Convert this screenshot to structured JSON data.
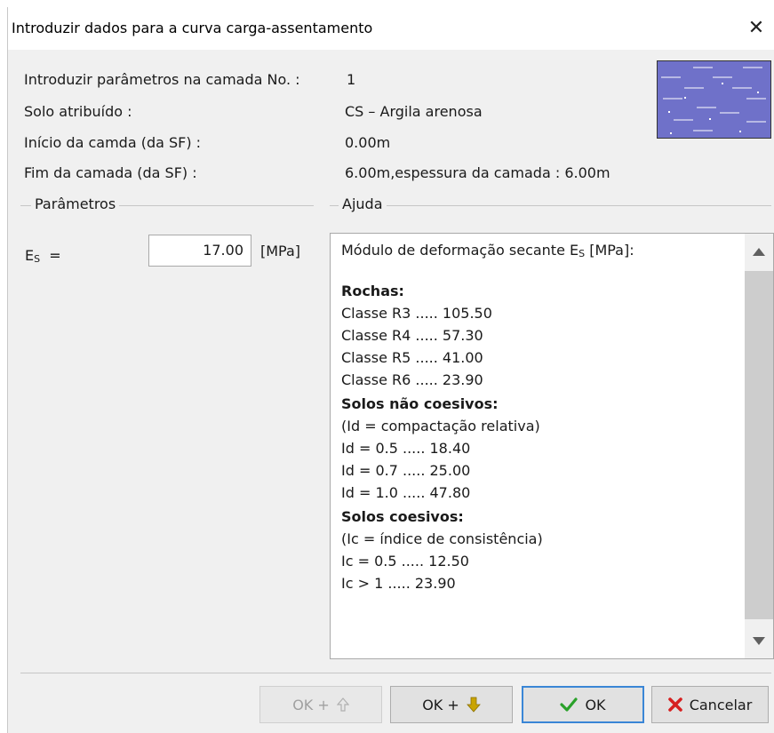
{
  "dialog": {
    "title": "Introduzir dados para a curva carga-assentamento",
    "close_glyph": "✕"
  },
  "info": {
    "layer_label": "Introduzir parâmetros na camada No. :",
    "layer_value": "1",
    "soil_label": "Solo atribuído :",
    "soil_value": "CS – Argila arenosa",
    "start_label": "Início da camda (da SF) :",
    "start_value": "0.00m",
    "end_label": "Fim da camada (da SF) :",
    "end_value": "6.00m,espessura da camada : 6.00m"
  },
  "groups": {
    "params_title": "Parâmetros",
    "help_title": "Ajuda"
  },
  "params": {
    "es_symbol": "E",
    "es_sub": "S",
    "es_eq": "=",
    "es_value": "17.00",
    "es_unit": "[MPa]"
  },
  "help": {
    "intro_a": "Módulo de deformação secante E",
    "intro_sub": "S",
    "intro_b": " [MPa]:",
    "rochas_title": "Rochas:",
    "rochas": [
      "Classe R3  .....  105.50",
      "Classe R4  .....    57.30",
      "Classe R5  .....    41.00",
      "Classe R6  .....    23.90"
    ],
    "ncoes_title": "Solos não coesivos:",
    "ncoes_note": "(Id = compactação relativa)",
    "ncoes": [
      "Id = 0.5  .....  18.40",
      "Id = 0.7  .....  25.00",
      "Id = 1.0  .....  47.80"
    ],
    "coes_title": "Solos coesivos:",
    "coes_note": "(Ic = índice de consistência)",
    "coes": [
      "Ic = 0.5  .....  12.50",
      "Ic > 1      .....  23.90"
    ]
  },
  "buttons": {
    "ok_up": "OK +",
    "ok_down": "OK +",
    "ok": "OK",
    "cancel": "Cancelar"
  },
  "colors": {
    "soil_fill": "#6f71c9",
    "arrow_down": "#c9a400",
    "check_green": "#2aa12a",
    "cancel_red": "#d62020",
    "focus_blue": "#3a86d6"
  }
}
